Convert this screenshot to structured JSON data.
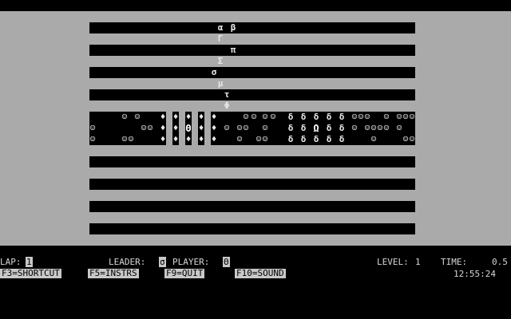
{
  "track": {
    "racers_above": [
      {
        "symbol": "α",
        "row": 0,
        "col": 0
      },
      {
        "symbol": "β",
        "row": 0,
        "col": 1
      },
      {
        "symbol": "Γ",
        "row": 1,
        "col": 0
      },
      {
        "symbol": "π",
        "row": 2,
        "col": 1
      },
      {
        "symbol": "Σ",
        "row": 3,
        "col": 0
      },
      {
        "symbol": "σ",
        "row": 4,
        "col": 0
      },
      {
        "symbol": "µ",
        "row": 5,
        "col": 0
      },
      {
        "symbol": "τ",
        "row": 6,
        "col": 1
      },
      {
        "symbol": "Φ",
        "row": 7,
        "col": 1
      }
    ],
    "obstacle_symbol": "☺",
    "fence_symbol": "♦",
    "delta_symbol": "δ",
    "player_symbol": "Θ",
    "leader_symbol": "Ω",
    "bonus_symbol": "☺"
  },
  "hud": {
    "lap_label": "LAP:",
    "lap_value": "1",
    "leader_label": "LEADER:",
    "leader_value": "σ",
    "player_label": "PLAYER:",
    "player_value": "Θ",
    "level_label": "LEVEL:",
    "level_value": "1",
    "time_label": "TIME:",
    "time_value": "0.5",
    "clock": "12:55:24",
    "keys": {
      "shortcut": "F3=SHORTCUT",
      "instrs": "F5=INSTRS",
      "quit": "F9=QUIT",
      "sound": "F10=SOUND"
    }
  }
}
